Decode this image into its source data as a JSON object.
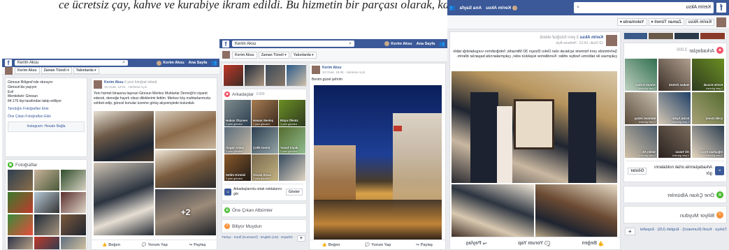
{
  "caption": "ce ücretsiz çay, kahve ve kurabiye ikram edildi. Bu hizmetin bir parçası olarak, kafenin yanında yer alan bir bölümde öğrencilere",
  "user": {
    "name": "Kerim Aksu",
    "nav_home": "Ana Sayfa"
  },
  "tabs": [
    "Kerim Aksu",
    "Zaman Tüneli ▾",
    "Yakınlarda ▾"
  ],
  "shot1": {
    "intro": [
      "Giresun Bölgesi'nde oturuyor",
      "Giresun'da yaşıyor",
      "Evli",
      "Memleketi: Giresun",
      "84.176 kişi tarafından takip ediliyor"
    ],
    "links": [
      "Tanıdığın Fotoğrafları Ekle",
      "Öne Çıkan Fotoğrafları Ekle"
    ],
    "instagram": "Instagram: Hesabı Bağla",
    "photos_title": "Fotoğraflar",
    "post": {
      "author": "Kerim Aksu",
      "verb": " 6 yeni fotoğraf ekledi.",
      "meta": "10 Ocak, 12:01 · Herkese Açık",
      "text": "Yeni hizmet binasına taşınan Giresun Merkez Muhtarlar Derneği'ni ziyaret ederek, derneğe hayırlı olsun dileklerimi ilettim. Merkez köy muhtarlarımızla sohbet edip, güncel konular üzerine görüş alışverişinde bulunduk.",
      "more_count": "+2"
    },
    "actions": [
      "Beğen",
      "Yorum Yap",
      "Paylaş"
    ]
  },
  "shot2": {
    "search": "Kerim Aksu",
    "friends_title": "Arkadaşlar",
    "friends_count": "3.000",
    "friends": [
      {
        "name": "Hakan Ölçmen",
        "sub": "1 yeni gönderi"
      },
      {
        "name": "Hasan Sevinç",
        "sub": "1 yeni gönderi"
      },
      {
        "name": "Rüya Öksüz",
        "sub": "1 yeni gönderi"
      },
      {
        "name": "Özgür Aslan",
        "sub": "1 yeni gönderi"
      },
      {
        "name": "Çelik Demir",
        "sub": ""
      },
      {
        "name": "Yusuf Kiyak",
        "sub": "1 yeni gönderi"
      },
      {
        "name": "Selim Kirmizi",
        "sub": "1 yeni gönderi"
      },
      {
        "name": "Özcan Koca",
        "sub": "1 yeni gönderi"
      }
    ],
    "find_friends": "Arkadaşlarınla ortak noktalarını gör",
    "find_button": "Göster",
    "featured_albums": "Öne Çıkan Albümler",
    "did_you_know": "Biliyor Muydun",
    "languages": "Türkçe · Kurdî (Kurmancî) · English (US) · Español",
    "post": {
      "author": "Kerim Aksu",
      "meta": "10 Ocak, 19:45 · Herkese Açık",
      "text": "Benim güzel şehrim"
    },
    "actions": [
      "Beğen",
      "Yorum Yap",
      "Paylaş"
    ]
  },
  "shot3": {
    "search": "Kerim Aksu",
    "friends_title": "Arkadaşlar",
    "friends_count": "3.000",
    "friends": [
      {
        "name": "Kerim Kocak",
        "sub": "1 yeni gönderi"
      },
      {
        "name": "Hakan Öztürk",
        "sub": ""
      },
      {
        "name": "Ahmet Kırkan",
        "sub": "1 yeni gönderi"
      },
      {
        "name": "Çelik Demir",
        "sub": ""
      },
      {
        "name": "Erdal Aydın",
        "sub": "1 yeni gönderi"
      },
      {
        "name": "Mehmet Aktaş",
        "sub": "1 yeni gönderi"
      },
      {
        "name": "Oğuzhan Koca",
        "sub": "1 yeni gönderi"
      },
      {
        "name": "Ali Yavuz",
        "sub": "1 yeni gönderi"
      },
      {
        "name": "Selim Ak",
        "sub": "1 yeni gönderi"
      }
    ],
    "find_friends": "Arkadaşlarınla ortak noktalarını gör",
    "find_button": "Göster",
    "featured_albums": "Öne Çıkan Albümler",
    "did_you_know": "Biliyor Muydun",
    "languages": "Türkçe · Kurdî (Kurmancî) · English (US) · Español",
    "post": {
      "author": "Kerim Aksu",
      "verb": " 3 yeni fotoğraf ekledi.",
      "meta": "13 Ocak, 14:13 · Herkese Açık",
      "text": "Şehrimizde yeni hizmete açılacak olan Deko Dizayn 3D Mimarlık, fotoğrafımın vurgulandığı tablo çalışması ile tablomu hediye ettiler. Kendilerine teşekkür eder, çalışmalarında başarılar dilerim."
    },
    "actions": [
      "Beğen",
      "Yorum Yap",
      "Paylaş"
    ]
  },
  "colors": {
    "facebook_blue": "#3b5998",
    "friends_icon": "#f35369",
    "albums_icon": "#42b72a",
    "know_icon": "#f7923b"
  }
}
